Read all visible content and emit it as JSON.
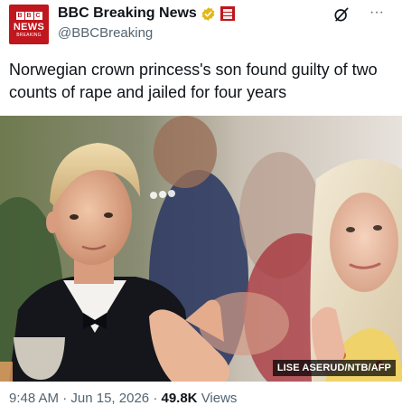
{
  "author": {
    "display_name": "BBC Breaking News",
    "handle": "@BBCBreaking",
    "avatar": {
      "line1": "BBC",
      "line2": "NEWS",
      "line3": "BREAKING",
      "color": "#c0161d"
    },
    "verified_badge": "gold-check-icon",
    "affiliate_badge": "bbc-affiliate-icon"
  },
  "actions": {
    "grok_icon": "grok-icon",
    "more_label": "···"
  },
  "tweet": {
    "text": "Norwegian crown princess's son found guilty of two counts of rape and jailed for four years"
  },
  "media": {
    "credit": "LISE ASERUD/NTB/AFP"
  },
  "meta": {
    "time": "9:48 AM",
    "separator": "·",
    "date": "Jun 15, 2026",
    "views_count": "49.8K",
    "views_label": "Views"
  },
  "colors": {
    "text": "#0f1419",
    "secondary": "#536471",
    "bbc_red": "#c0161d",
    "gold": "#e2b719"
  }
}
